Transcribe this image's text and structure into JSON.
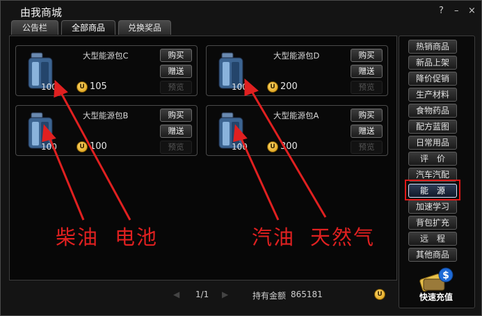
{
  "window": {
    "title": "由我商城",
    "help": "?",
    "minimize": "–",
    "close": "×"
  },
  "tabs": [
    {
      "label": "公告栏",
      "active": false
    },
    {
      "label": "全部商品",
      "active": true
    },
    {
      "label": "兑换奖品",
      "active": false
    }
  ],
  "products": [
    {
      "name": "大型能源包C",
      "qty": "100",
      "price": "105",
      "buy": "购买",
      "gift": "赠送",
      "preview": "预览"
    },
    {
      "name": "大型能源包D",
      "qty": "100",
      "price": "200",
      "buy": "购买",
      "gift": "赠送",
      "preview": "预览"
    },
    {
      "name": "大型能源包B",
      "qty": "100",
      "price": "100",
      "buy": "购买",
      "gift": "赠送",
      "preview": "预览"
    },
    {
      "name": "大型能源包A",
      "qty": "100",
      "price": "300",
      "buy": "购买",
      "gift": "赠送",
      "preview": "预览"
    }
  ],
  "coin_symbol": "U",
  "pager": {
    "prev": "◀",
    "text": "1/1",
    "next": "▶"
  },
  "balance": {
    "label": "持有金额",
    "value": "865181"
  },
  "categories": [
    {
      "label": "热销商品"
    },
    {
      "label": "新品上架"
    },
    {
      "label": "降价促销"
    },
    {
      "label": "生产材料"
    },
    {
      "label": "食物药品"
    },
    {
      "label": "配方蓝图"
    },
    {
      "label": "日常用品"
    },
    {
      "label": "评　价"
    },
    {
      "label": "汽车汽配"
    },
    {
      "label": "能　源",
      "selected": true
    },
    {
      "label": "加速学习"
    },
    {
      "label": "背包扩充"
    },
    {
      "label": "远　程"
    },
    {
      "label": "其他商品"
    }
  ],
  "recharge": {
    "label": "快速充值",
    "icon": "money-recharge-icon"
  },
  "annotations": {
    "diesel": "柴油",
    "battery": "电池",
    "gasoline": "汽油",
    "natural_gas": "天然气",
    "color": "#e02020"
  }
}
